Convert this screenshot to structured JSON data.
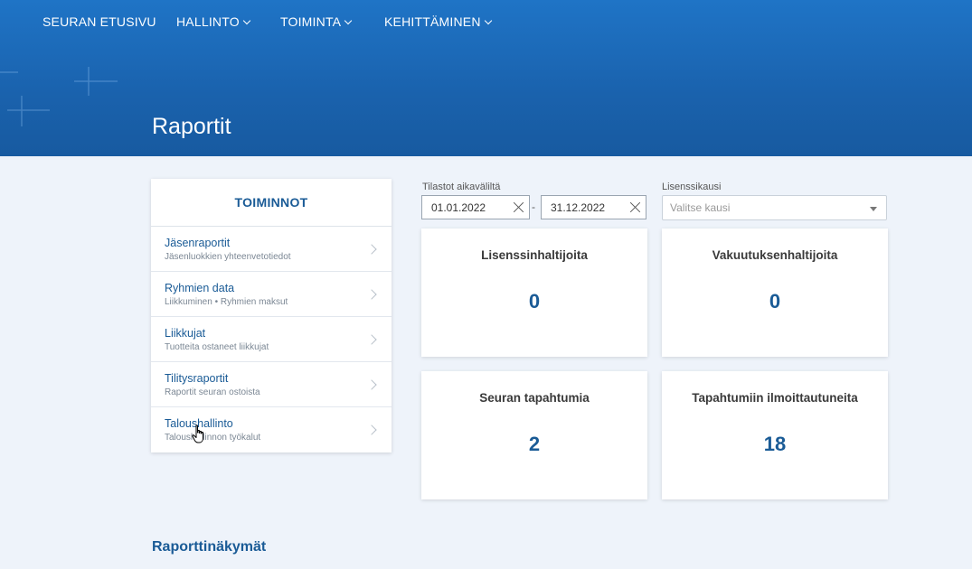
{
  "nav": {
    "items": [
      {
        "label": "SEURAN ETUSIVU",
        "dropdown": false
      },
      {
        "label": "HALLINTO",
        "dropdown": true
      },
      {
        "label": "TOIMINTA",
        "dropdown": true
      },
      {
        "label": "KEHITTÄMINEN",
        "dropdown": true
      }
    ]
  },
  "page": {
    "title": "Raportit"
  },
  "sidebar": {
    "header": "TOIMINNOT",
    "items": [
      {
        "title": "Jäsenraportit",
        "subtitle": "Jäsenluokkien yhteenvetotiedot"
      },
      {
        "title": "Ryhmien data",
        "subtitle": "Liikkuminen • Ryhmien maksut"
      },
      {
        "title": "Liikkujat",
        "subtitle": "Tuotteita ostaneet liikkujat"
      },
      {
        "title": "Tilitysraportit",
        "subtitle": "Raportit seuran ostoista"
      },
      {
        "title": "Taloushallinto",
        "subtitle": "Taloushallinnon työkalut"
      }
    ]
  },
  "filters": {
    "date_label": "Tilastot aikaväliltä",
    "start_date": "01.01.2022",
    "separator": "-",
    "end_date": "31.12.2022",
    "season_label": "Lisenssikausi",
    "season_placeholder": "Valitse kausi"
  },
  "stats": [
    {
      "title": "Lisenssinhaltijoita",
      "value": "0"
    },
    {
      "title": "Vakuutuksenhaltijoita",
      "value": "0"
    },
    {
      "title": "Seuran tapahtumia",
      "value": "2"
    },
    {
      "title": "Tapahtumiin ilmoittautuneita",
      "value": "18"
    }
  ],
  "sections": {
    "reports_title": "Raporttinäkymät"
  },
  "colors": {
    "accent": "#1a5b96",
    "hero": "#1f74c6",
    "background": "#eef3fa"
  }
}
